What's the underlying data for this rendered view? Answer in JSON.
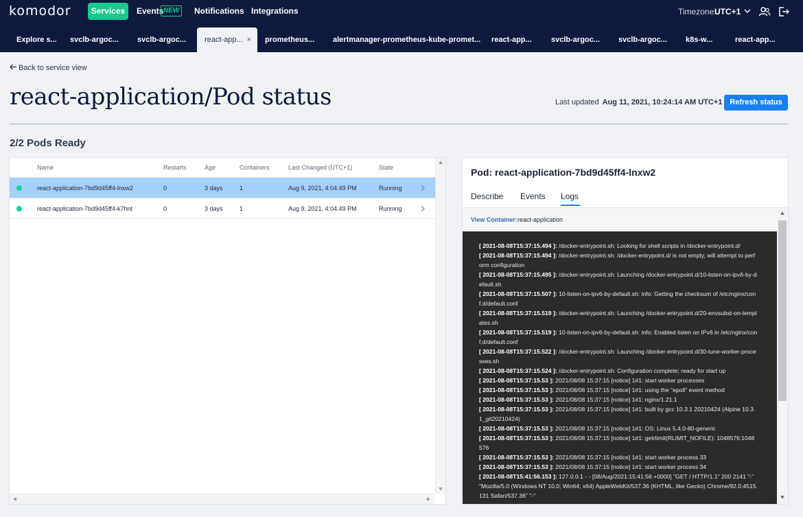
{
  "app": {
    "logo": "komodor"
  },
  "topnav": {
    "services": "Services",
    "events": "Events",
    "events_badge": "NEW",
    "notifications": "Notifications",
    "integrations": "Integrations",
    "timezone_label": "Timezone:",
    "timezone_value": "UTC+1"
  },
  "tabs": [
    {
      "label": "Explore s..."
    },
    {
      "label": "svclb-argoc..."
    },
    {
      "label": "svclb-argoc..."
    },
    {
      "label": "react-app...",
      "active": true,
      "close": "×"
    },
    {
      "label": "prometheus..."
    },
    {
      "label": "alertmanager-prometheus-kube-promet..."
    },
    {
      "label": "react-app..."
    },
    {
      "label": "svclb-argoc..."
    },
    {
      "label": "svclb-argoc..."
    },
    {
      "label": "k8s-w..."
    },
    {
      "label": "react-app..."
    }
  ],
  "header": {
    "back_label": "Back to service view",
    "title": "react-application/Pod status",
    "last_updated_label": "Last updated",
    "last_updated_value": "Aug 11, 2021, 10:24:14 AM UTC+1",
    "refresh_label": "Refresh status"
  },
  "pods": {
    "ready_label": "2/2 Pods Ready",
    "columns": [
      "Name",
      "Restarts",
      "Age",
      "Containers",
      "Last Changed (UTC+1)",
      "State"
    ],
    "rows": [
      {
        "name": "react-application-7bd9d45ff4-lnxw2",
        "restarts": "0",
        "age": "3 days",
        "containers": "1",
        "last_changed": "Aug 9, 2021, 4:04:49 PM",
        "state": "Running",
        "selected": true
      },
      {
        "name": "react-application-7bd9d45ff4-k7hnt",
        "restarts": "0",
        "age": "3 days",
        "containers": "1",
        "last_changed": "Aug 9, 2021, 4:04:49 PM",
        "state": "Running",
        "selected": false
      }
    ],
    "status_color": "#17d38f"
  },
  "detail": {
    "title": "Pod: react-application-7bd9d45ff4-lnxw2",
    "tabs": [
      "Describe",
      "Events",
      "Logs"
    ],
    "active_tab": "Logs",
    "view_container_label": "View Container:",
    "view_container_value": "react-application",
    "logs": [
      {
        "ts": "[ 2021-08-08T15:37:15.494 ]:",
        "msg": " /docker-entrypoint.sh: Looking for shell scripts in /docker-entrypoint.d/"
      },
      {
        "ts": "[ 2021-08-08T15:37:15.494 ]:",
        "msg": " /docker-entrypoint.sh: /docker-entrypoint.d/ is not empty, will attempt to perform configuration"
      },
      {
        "ts": "[ 2021-08-08T15:37:15.495 ]:",
        "msg": " /docker-entrypoint.sh: Launching /docker-entrypoint.d/10-listen-on-ipv6-by-default.sh"
      },
      {
        "ts": "[ 2021-08-08T15:37:15.507 ]:",
        "msg": " 10-listen-on-ipv6-by-default.sh: info: Getting the checksum of /etc/nginx/conf.d/default.conf"
      },
      {
        "ts": "[ 2021-08-08T15:37:15.519 ]:",
        "msg": " /docker-entrypoint.sh: Launching /docker-entrypoint.d/20-envsubst-on-templates.sh"
      },
      {
        "ts": "[ 2021-08-08T15:37:15.519 ]:",
        "msg": " 10-listen-on-ipv6-by-default.sh: info: Enabled listen on IPv6 in /etc/nginx/conf.d/default.conf"
      },
      {
        "ts": "[ 2021-08-08T15:37:15.522 ]:",
        "msg": " /docker-entrypoint.sh: Launching /docker-entrypoint.d/30-tune-worker-processes.sh"
      },
      {
        "ts": "[ 2021-08-08T15:37:15.524 ]:",
        "msg": " /docker-entrypoint.sh: Configuration complete; ready for start up"
      },
      {
        "ts": "[ 2021-08-08T15:37:15.53 ]:",
        "msg": " 2021/08/08 15:37:15 [notice] 1#1: start worker processes"
      },
      {
        "ts": "[ 2021-08-08T15:37:15.53 ]:",
        "msg": " 2021/08/08 15:37:15 [notice] 1#1: using the \"epoll\" event method"
      },
      {
        "ts": "[ 2021-08-08T15:37:15.53 ]:",
        "msg": " 2021/08/08 15:37:15 [notice] 1#1: nginx/1.21.1"
      },
      {
        "ts": "[ 2021-08-08T15:37:15.53 ]:",
        "msg": " 2021/08/08 15:37:15 [notice] 1#1: built by gcc 10.3.1 20210424 (Alpine 10.3.1_git20210424)"
      },
      {
        "ts": "[ 2021-08-08T15:37:15.53 ]:",
        "msg": " 2021/08/08 15:37:15 [notice] 1#1: OS: Linux 5.4.0-80-generic"
      },
      {
        "ts": "[ 2021-08-08T15:37:15.53 ]:",
        "msg": " 2021/08/08 15:37:15 [notice] 1#1: getrlimit(RLIMIT_NOFILE): 1048576:1048576"
      },
      {
        "ts": "[ 2021-08-08T15:37:15.53 ]:",
        "msg": " 2021/08/08 15:37:15 [notice] 1#1: start worker process 33"
      },
      {
        "ts": "[ 2021-08-08T15:37:15.53 ]:",
        "msg": " 2021/08/08 15:37:15 [notice] 1#1: start worker process 34"
      },
      {
        "ts": "[ 2021-08-08T15:41:56.153 ]:",
        "msg": " 127.0.0.1 - - [08/Aug/2021:15:41:56 +0000] \"GET / HTTP/1.1\" 200 2141 \"-\" \"Mozilla/5.0 (Windows NT 10.0; Win64; x64) AppleWebKit/537.36 (KHTML, like Gecko) Chrome/92.0.4515.131 Safari/537.36\" \"-\""
      }
    ]
  },
  "colors": {
    "nav_bg": "#0e1a3d",
    "accent": "#17c98c",
    "primary_button": "#1a7ff2",
    "selected_row": "#a4d0fb",
    "log_bg": "#2b2b2b"
  },
  "icons": {
    "timezone_chevron": "chevron-down-icon",
    "user": "users-icon",
    "logout": "logout-icon",
    "back": "arrow-left-icon",
    "row": "chevron-right-icon"
  }
}
